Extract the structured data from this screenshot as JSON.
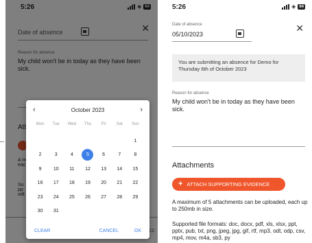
{
  "status_bar": {
    "time": "5:26",
    "battery": "64"
  },
  "form": {
    "date_label": "Date of absence",
    "date_value": "05/10/2023",
    "info_message": "You are submitting an absence for Demo for Thursday 6th of October 2023",
    "reason_label": "Reason for absence",
    "reason_value": "My child won't be in today as they have been sick.",
    "attachments_title": "Attachments",
    "attach_button_label": "ATTACH SUPPORTING EVIDENCE",
    "attachments_limit": "A maximum of 5 attachments can be uploaded, each up to 250mb in size.",
    "supported_formats": "Supported file formats: doc, docx, pdf, xls, xlsx, ppt, pptx, pub, txt, png, jpeg, jpg, gif, rtf, mp3, odt, odp, csv, mp4, mov, m4a, sb3, py"
  },
  "background_fragments": {
    "att": "Att",
    "a1_line1": "A m",
    "a1_line2": "eac",
    "a2_line1": "Su",
    "a2_line2": "pp",
    "a2_line3": "odt",
    "scc": "SCC"
  },
  "date_picker": {
    "month_title": "October 2023",
    "prev_icon": "chevron-left-icon",
    "next_icon": "chevron-right-icon",
    "weekdays": [
      "Mon",
      "Tue",
      "Wed",
      "Thu",
      "Fri",
      "Sat",
      "Sun"
    ],
    "weeks": [
      [
        "",
        "",
        "",
        "",
        "",
        "",
        "1"
      ],
      [
        "2",
        "3",
        "4",
        "5",
        "6",
        "7",
        "8"
      ],
      [
        "9",
        "10",
        "11",
        "12",
        "13",
        "14",
        "15"
      ],
      [
        "16",
        "17",
        "18",
        "19",
        "20",
        "21",
        "22"
      ],
      [
        "23",
        "24",
        "25",
        "26",
        "27",
        "28",
        "29"
      ],
      [
        "30",
        "31",
        "",
        "",
        "",
        "",
        ""
      ]
    ],
    "selected_day": "5",
    "clear_label": "CLEAR",
    "cancel_label": "CANCEL",
    "ok_label": "OK"
  },
  "colors": {
    "accent_blue": "#3f7fe8",
    "attach_orange": "#f0562c",
    "info_bg": "#eeeeee"
  }
}
